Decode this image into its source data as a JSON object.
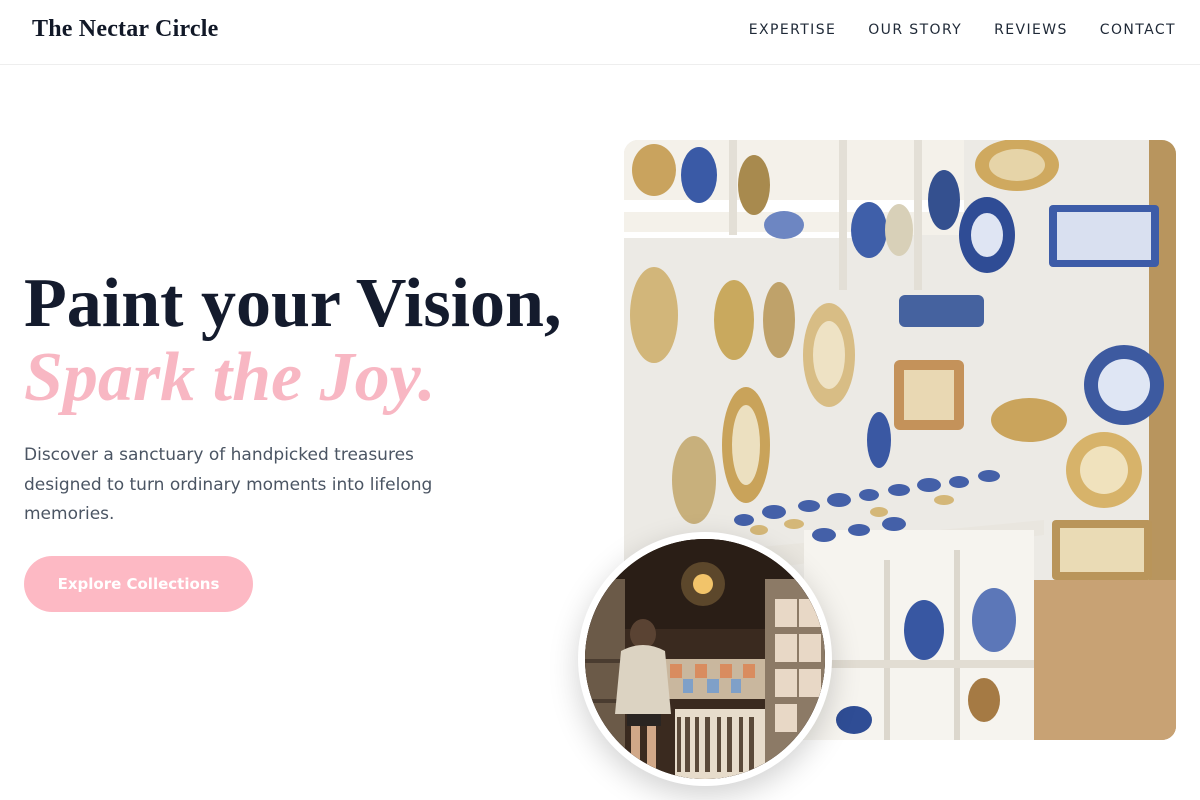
{
  "brand": {
    "name": "The Nectar Circle"
  },
  "nav": {
    "items": [
      {
        "label": "EXPERTISE"
      },
      {
        "label": "OUR STORY"
      },
      {
        "label": "REVIEWS"
      },
      {
        "label": "CONTACT"
      }
    ]
  },
  "hero": {
    "headline_line1": "Paint your Vision,",
    "headline_line2": "Spark the Joy.",
    "description": "Discover a sanctuary of handpicked treasures designed to turn ordinary moments into lifelong memories.",
    "cta_label": "Explore Collections"
  },
  "colors": {
    "accent_pink": "#fdb9c4",
    "headline_pink": "#f8b7c3",
    "headline_dark": "#141b2d",
    "body_text": "#4b5563"
  }
}
